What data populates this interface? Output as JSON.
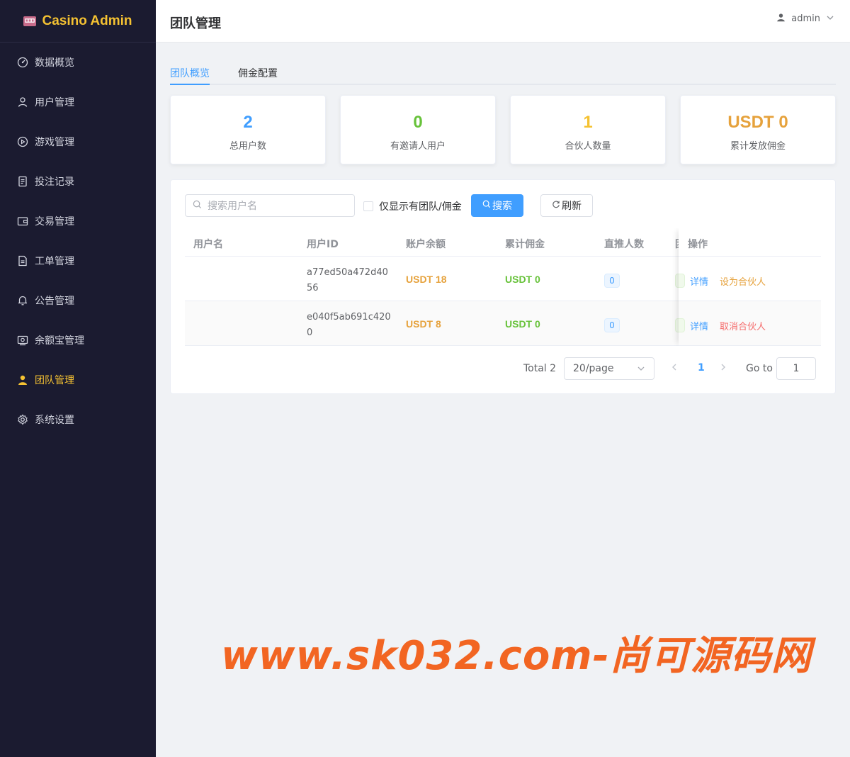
{
  "brand": {
    "title": "Casino Admin",
    "icon": "slot-machine-icon"
  },
  "sidebar": {
    "items": [
      {
        "label": "数据概览",
        "icon": "dashboard-icon"
      },
      {
        "label": "用户管理",
        "icon": "user-icon"
      },
      {
        "label": "游戏管理",
        "icon": "play-icon"
      },
      {
        "label": "投注记录",
        "icon": "document-icon"
      },
      {
        "label": "交易管理",
        "icon": "wallet-icon"
      },
      {
        "label": "工单管理",
        "icon": "ticket-icon"
      },
      {
        "label": "公告管理",
        "icon": "bell-icon"
      },
      {
        "label": "余额宝管理",
        "icon": "vault-icon"
      },
      {
        "label": "团队管理",
        "icon": "team-icon",
        "active": true
      },
      {
        "label": "系统设置",
        "icon": "gear-icon"
      }
    ]
  },
  "header": {
    "title": "团队管理",
    "user": "admin"
  },
  "tabs": [
    {
      "label": "团队概览",
      "active": true
    },
    {
      "label": "佣金配置"
    }
  ],
  "stats": [
    {
      "value": "2",
      "label": "总用户数",
      "color": "#409eff"
    },
    {
      "value": "0",
      "label": "有邀请人用户",
      "color": "#67c23a"
    },
    {
      "value": "1",
      "label": "合伙人数量",
      "color": "#f5c232"
    },
    {
      "value": "USDT 0",
      "label": "累计发放佣金",
      "color": "#e6a23c"
    }
  ],
  "toolbar": {
    "search_placeholder": "搜索用户名",
    "checkbox_label": "仅显示有团队/佣金",
    "search_button": "搜索",
    "refresh_button": "刷新"
  },
  "table": {
    "headers": {
      "username": "用户名",
      "user_id": "用户ID",
      "balance": "账户余额",
      "commission": "累计佣金",
      "direct": "直推人数",
      "team": "团队人数",
      "actions": "操作"
    },
    "rows": [
      {
        "username": "",
        "user_id": "a77ed50a472d4056",
        "balance": "USDT 18",
        "commission": "USDT 0",
        "direct": "0",
        "detail": "详情",
        "action": "设为合伙人"
      },
      {
        "username": "",
        "user_id": "e040f5ab691c4200",
        "balance": "USDT 8",
        "commission": "USDT 0",
        "direct": "0",
        "detail": "详情",
        "action": "取消合伙人"
      }
    ]
  },
  "pagination": {
    "total": "Total 2",
    "page_size": "20/page",
    "current_page": "1",
    "goto_label": "Go to",
    "goto_value": "1"
  },
  "watermark": "www.sk032.com-尚可源码网"
}
